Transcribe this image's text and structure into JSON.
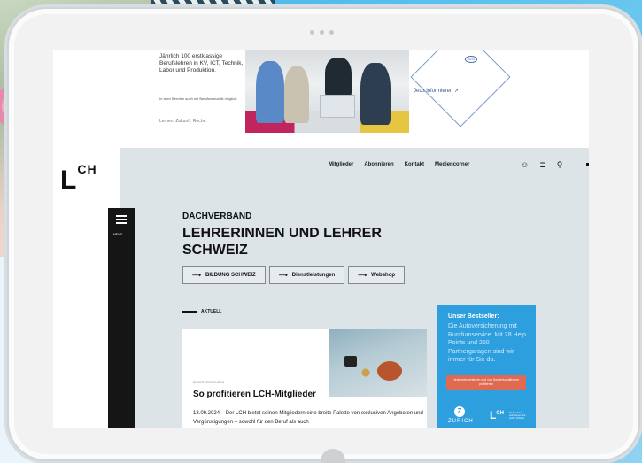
{
  "banner": {
    "headline": "Jährlich 100 erstklassige Berufslehren in KV, ICT, Technik, Labor und Produktion.",
    "small_text": "In allen Berufen auch mit Berufsmaturität möglich.",
    "links": "Lernen. Zukunft. Roche.",
    "cta": "Jetzt informieren",
    "roche_logo": "Roche"
  },
  "header": {
    "logo": "L",
    "logo_sup": "CH",
    "nav": [
      "Mitglieder",
      "Abonnieren",
      "Kontakt",
      "Mediencorner"
    ],
    "icons": [
      "user-icon",
      "cart-icon",
      "search-icon"
    ]
  },
  "menu": {
    "label": "MENÜ"
  },
  "hero": {
    "kicker": "DACHVERBAND",
    "title": "LEHRERINNEN UND LEHRER SCHWEIZ",
    "buttons": [
      "BILDUNG SCHWEIZ",
      "Dienstleistungen",
      "Webshop"
    ],
    "arrow": "⟶"
  },
  "news": {
    "section_label": "AKTUELL",
    "card": {
      "tag": "DIENSTLEISTUNGEN",
      "title": "So profitieren LCH-Mitglieder",
      "text": "13.09.2024 – Der LCH bietet seinen Mitgliedern eine breite Palette von exklusiven Angeboten und Vergünstigungen – sowohl für den Beruf als auch"
    }
  },
  "ad": {
    "title": "Unser Bestseller:",
    "text": "Die Autoversicherung mit Rundumservice. Mit 28 Help Points und 250 Partnergaragen sind wir immer für Sie da.",
    "button": "Jetzt mehr erfahren und von Sonderkonditionen profitieren",
    "zurich": "ZURICH",
    "zurich_mark": "Z",
    "lch": "L",
    "lch_sup": "CH",
    "lch_small": "Dachverband Lehrerinnen und Lehrer Schweiz"
  }
}
